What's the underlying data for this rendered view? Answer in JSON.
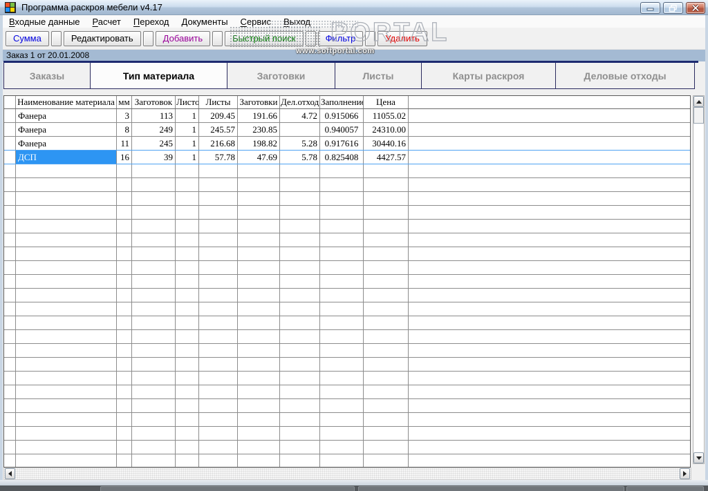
{
  "window": {
    "title": "Программа раскроя мебели v4.17"
  },
  "icons": {
    "app": "windows-logo",
    "minimize": "minimize-dash",
    "maximize": "restore-squares",
    "close": "close-x",
    "scroll_up": "arrow-up",
    "scroll_down": "arrow-down",
    "scroll_left": "arrow-left",
    "scroll_right": "arrow-right"
  },
  "menu": {
    "items": [
      "Входные данные",
      "Расчет",
      "Переход",
      "Документы",
      "Сервис",
      "Выход"
    ]
  },
  "toolbar": {
    "buttons": [
      {
        "label": "Сумма",
        "color": "#0000e0"
      },
      {
        "label": "Редактировать",
        "color": "#000000"
      },
      {
        "label": "Добавить",
        "color": "#990099"
      },
      {
        "label": "Быстрый поиск",
        "color": "#007800"
      },
      {
        "label": "Фильтр",
        "color": "#0000e0"
      },
      {
        "label": "Удалить",
        "color": "#e00000"
      }
    ]
  },
  "watermark": {
    "big_text": "PORTAL",
    "small_text": "www.softportal.com"
  },
  "order_bar": {
    "text": "Заказ 1 от 20.01.2008"
  },
  "tabs": {
    "items": [
      {
        "label": "Заказы",
        "active": false
      },
      {
        "label": "Тип материала",
        "active": true
      },
      {
        "label": "Заготовки",
        "active": false
      },
      {
        "label": "Листы",
        "active": false
      },
      {
        "label": "Карты раскроя",
        "active": false
      },
      {
        "label": "Деловые отходы",
        "active": false
      }
    ]
  },
  "table": {
    "columns": [
      "Наименование материала",
      "мм",
      "Заготовок",
      "Листов",
      "Листы",
      "Заготовки",
      "Дел.отход",
      "Заполнение",
      "Цена"
    ],
    "rows": [
      [
        "Фанера",
        "3",
        "113",
        "1",
        "209.45",
        "191.66",
        "4.72",
        "0.915066",
        "11055.02"
      ],
      [
        "Фанера",
        "8",
        "249",
        "1",
        "245.57",
        "230.85",
        "",
        "0.940057",
        "24310.00"
      ],
      [
        "Фанера",
        "11",
        "245",
        "1",
        "216.68",
        "198.82",
        "5.28",
        "0.917616",
        "30440.16"
      ],
      [
        "ДСП",
        "16",
        "39",
        "1",
        "57.78",
        "47.69",
        "5.78",
        "0.825408",
        "4427.57"
      ]
    ],
    "selected_row": 3,
    "selected_col": 0,
    "empty_row_count": 22
  },
  "colors": {
    "selection_bg": "#2d95f3",
    "selection_border": "#4ea2f2",
    "tab_line": "#1d2a70",
    "order_bar_bg": "#a4bad3",
    "titlebar_top": "#eaf2fa",
    "titlebar_bottom": "#a2b8d0"
  }
}
